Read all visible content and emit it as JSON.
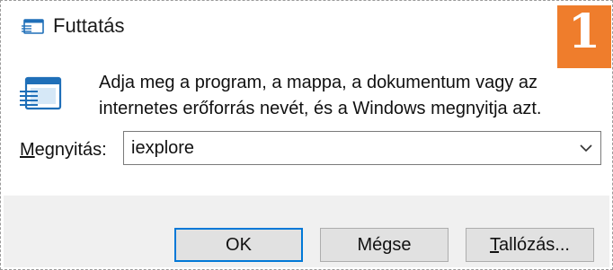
{
  "window": {
    "title": "Futtatás",
    "badge_number": "1"
  },
  "icons": {
    "title_icon": "run-dialog-icon",
    "main_icon": "run-dialog-icon",
    "dropdown_icon": "chevron-down-icon"
  },
  "dialog": {
    "description_line1": "Adja meg a program, a mappa, a dokumentum vagy az",
    "description_line2": "internetes erőforrás nevét, és a Windows megnyitja azt.",
    "open_label_accel": "M",
    "open_label_rest": "egnyitás:",
    "open_value": "iexplore"
  },
  "buttons": {
    "ok_label": "OK",
    "cancel_label": "Mégse",
    "browse_label_accel": "T",
    "browse_label_rest": "allózás..."
  },
  "colors": {
    "badge": "#ef7d2c",
    "focus_border": "#0078d7",
    "footer_bg": "#f0f0f0",
    "button_bg": "#e1e1e1"
  }
}
